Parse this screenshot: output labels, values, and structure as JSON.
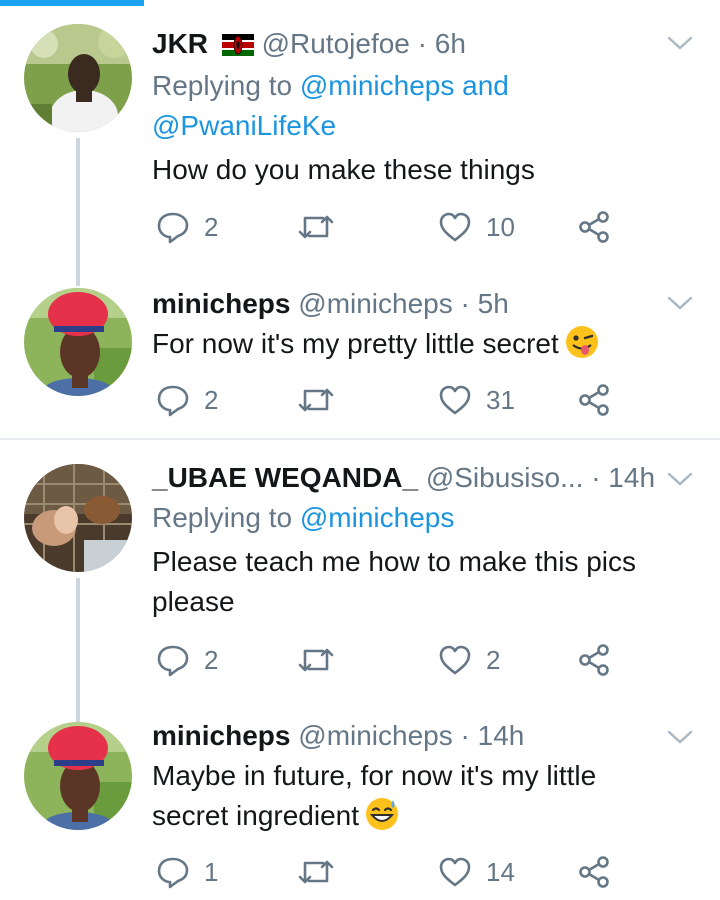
{
  "tweets": [
    {
      "name": "JKR",
      "handle": "@Rutojefoe",
      "time": "· 6h",
      "reply_prefix": "Replying to",
      "reply_mention_1": "@minicheps",
      "reply_and": "and",
      "reply_mention_2": "@PwaniLifeKe",
      "text": "How do you make these things",
      "replies": "2",
      "likes": "10"
    },
    {
      "name": "minicheps",
      "handle": "@minicheps",
      "time": "· 5h",
      "text": "For now it's my pretty little secret",
      "emoji": "winking-face-tongue",
      "replies": "2",
      "likes": "31"
    },
    {
      "name": "_UBAE WEQANDA_",
      "handle": "@Sibusiso...",
      "time": "· 14h",
      "reply_prefix": "Replying to",
      "reply_mention_1": "@minicheps",
      "text_line1": "Please teach me how to make this pics",
      "text_line2": "please",
      "replies": "2",
      "likes": "2"
    },
    {
      "name": "minicheps",
      "handle": "@minicheps",
      "time": "· 14h",
      "text_line1": "Maybe in future, for now it's my little",
      "text_line2": "secret ingredient",
      "emoji": "grinning-sweat",
      "replies": "1",
      "likes": "14"
    }
  ],
  "colors": {
    "accent": "#1da1f2",
    "link": "#1b95e0",
    "secondary": "#657786",
    "divider": "#e6ecf0"
  },
  "icons": [
    "reply-icon",
    "retweet-icon",
    "like-icon",
    "share-icon",
    "chevron-down-icon",
    "kenya-flag-icon"
  ]
}
